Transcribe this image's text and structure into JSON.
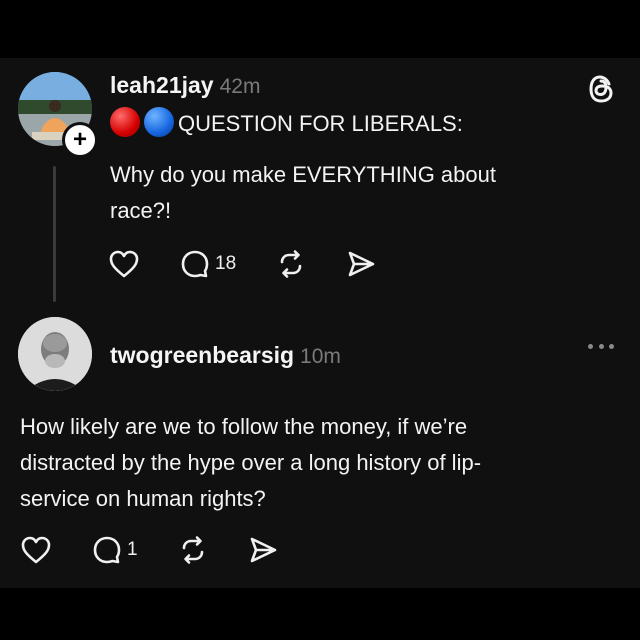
{
  "post": {
    "username": "leah21jay",
    "time": "42m",
    "title_line": "QUESTION FOR LIBERALS:",
    "body_line1": "Why do you make EVERYTHING about",
    "body_line2": "race?!",
    "reply_count": "18",
    "follow_glyph": "+"
  },
  "reply": {
    "username": "twogreenbearsig",
    "time": "10m",
    "line1": "How likely are we to follow the money, if we’re",
    "line2": "distracted by the hype over a long history of lip-",
    "line3": "service on human rights?",
    "reply_count": "1"
  },
  "colors": {
    "background": "#101010",
    "text": "#f3f3f3",
    "muted": "#7a7a7a",
    "red_dot": "#d50000",
    "blue_dot": "#1565e0"
  },
  "icons": {
    "app_logo": "threads-logo-icon",
    "like": "heart-icon",
    "reply": "comment-icon",
    "repost": "repost-icon",
    "share": "send-icon",
    "more": "more-dots-icon"
  }
}
